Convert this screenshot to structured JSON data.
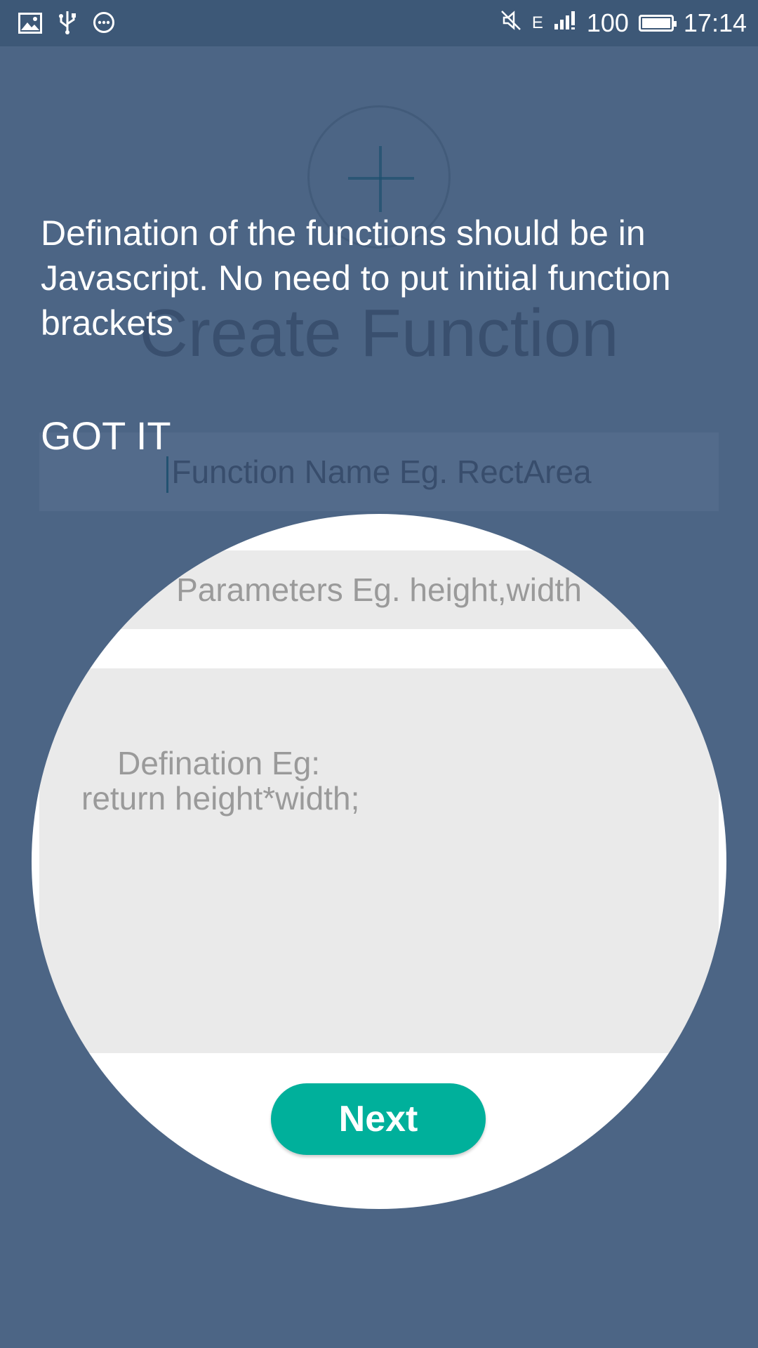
{
  "status_bar": {
    "left_icons": [
      "image-icon",
      "usb-icon",
      "more-icon"
    ],
    "network": "E",
    "battery_level": "100",
    "time": "17:14"
  },
  "screen": {
    "title": "Create Function",
    "function_name_placeholder": "Function Name Eg. RectArea",
    "parameters_placeholder": "Parameters Eg. height,width",
    "definition_placeholder": "Defination Eg:\nreturn height*width;",
    "next_label": "Next"
  },
  "coach": {
    "message": "Defination of the functions should be in Javascript. No need to put initial function brackets",
    "dismiss_label": "GOT IT"
  },
  "colors": {
    "overlay": "#4c6585",
    "accent": "#00b09b",
    "status_bar": "#3d5877"
  }
}
